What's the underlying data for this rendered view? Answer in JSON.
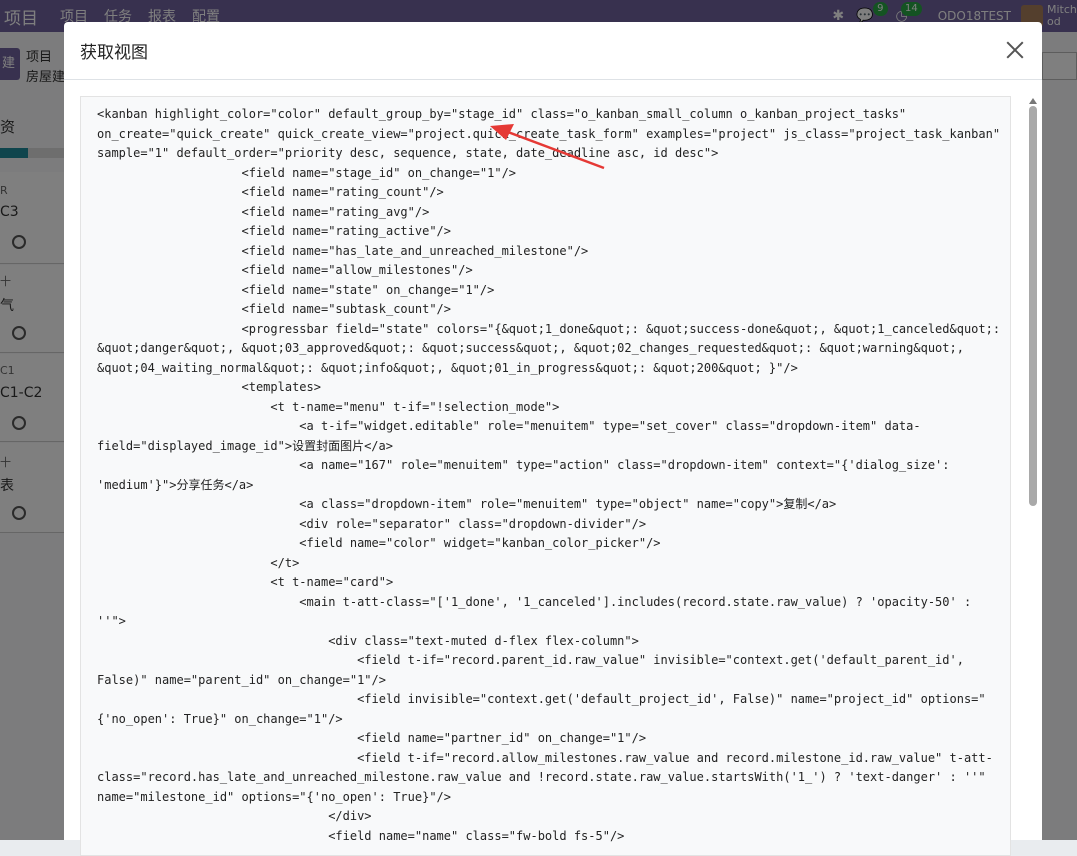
{
  "navbar": {
    "app_name": "项目",
    "menus": [
      "项目",
      "任务",
      "报表",
      "配置"
    ],
    "messages_badge": "9",
    "activity_badge": "14",
    "database": "ODO18TEST",
    "user_name": "Mitch",
    "user_company": "od"
  },
  "background": {
    "new_button": "建",
    "breadcrumb_parent": "项目",
    "breadcrumb_current": "房屋建",
    "column_title": "资",
    "cards": [
      {
        "tag": "R",
        "title": "C3"
      },
      {
        "tag": "十",
        "title": "气"
      },
      {
        "tag": "C1",
        "title": "C1-C2"
      },
      {
        "tag": "十",
        "title": "表"
      }
    ]
  },
  "modal": {
    "title": "获取视图",
    "code_lines": [
      "<kanban highlight_color=\"color\" default_group_by=\"stage_id\" class=\"o_kanban_small_column o_kanban_project_tasks\"",
      "on_create=\"quick_create\" quick_create_view=\"project.quick_create_task_form\" examples=\"project\" js_class=\"project_task_kanban\"",
      "sample=\"1\" default_order=\"priority desc, sequence, state, date_deadline asc, id desc\">",
      "                    <field name=\"stage_id\" on_change=\"1\"/>",
      "                    <field name=\"rating_count\"/>",
      "                    <field name=\"rating_avg\"/>",
      "                    <field name=\"rating_active\"/>",
      "                    <field name=\"has_late_and_unreached_milestone\"/>",
      "                    <field name=\"allow_milestones\"/>",
      "                    <field name=\"state\" on_change=\"1\"/>",
      "                    <field name=\"subtask_count\"/>",
      "                    <progressbar field=\"state\" colors=\"{&quot;1_done&quot;: &quot;success-done&quot;, &quot;1_canceled&quot;:",
      "&quot;danger&quot;, &quot;03_approved&quot;: &quot;success&quot;, &quot;02_changes_requested&quot;: &quot;warning&quot;,",
      "&quot;04_waiting_normal&quot;: &quot;info&quot;, &quot;01_in_progress&quot;: &quot;200&quot; }\"/>",
      "                    <templates>",
      "                        <t t-name=\"menu\" t-if=\"!selection_mode\">",
      "                            <a t-if=\"widget.editable\" role=\"menuitem\" type=\"set_cover\" class=\"dropdown-item\" data-",
      "field=\"displayed_image_id\">设置封面图片</a>",
      "                            <a name=\"167\" role=\"menuitem\" type=\"action\" class=\"dropdown-item\" context=\"{'dialog_size':",
      "'medium'}\">分享任务</a>",
      "                            <a class=\"dropdown-item\" role=\"menuitem\" type=\"object\" name=\"copy\">复制</a>",
      "                            <div role=\"separator\" class=\"dropdown-divider\"/>",
      "                            <field name=\"color\" widget=\"kanban_color_picker\"/>",
      "                        </t>",
      "                        <t t-name=\"card\">",
      "                            <main t-att-class=\"['1_done', '1_canceled'].includes(record.state.raw_value) ? 'opacity-50' :",
      "''\">",
      "                                <div class=\"text-muted d-flex flex-column\">",
      "                                    <field t-if=\"record.parent_id.raw_value\" invisible=\"context.get('default_parent_id',",
      "False)\" name=\"parent_id\" on_change=\"1\"/>",
      "                                    <field invisible=\"context.get('default_project_id', False)\" name=\"project_id\" options=\"",
      "{'no_open': True}\" on_change=\"1\"/>",
      "                                    <field name=\"partner_id\" on_change=\"1\"/>",
      "                                    <field t-if=\"record.allow_milestones.raw_value and record.milestone_id.raw_value\" t-att-",
      "class=\"record.has_late_and_unreached_milestone.raw_value and !record.state.raw_value.startsWith('1_') ? 'text-danger' : ''\"",
      "name=\"milestone_id\" options=\"{'no_open': True}\"/>",
      "                                </div>",
      "                                <field name=\"name\" class=\"fw-bold fs-5\"/>"
    ]
  },
  "colors": {
    "navbar": "#71639e",
    "annotation_arrow": "#e53935"
  }
}
